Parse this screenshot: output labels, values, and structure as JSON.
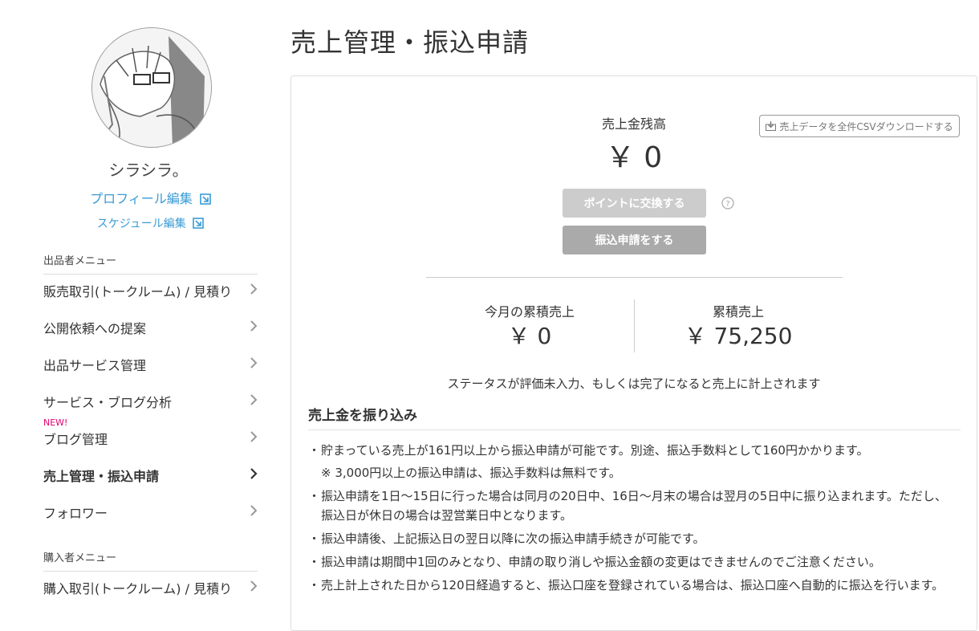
{
  "sidebar": {
    "username": "シラシラ。",
    "profile_edit": "プロフィール編集",
    "schedule_edit": "スケジュール編集",
    "seller_menu_heading": "出品者メニュー",
    "seller_items": [
      {
        "label": "販売取引(トークルーム) / 見積り"
      },
      {
        "label": "公開依頼への提案"
      },
      {
        "label": "出品サービス管理"
      },
      {
        "label": "サービス・ブログ分析"
      },
      {
        "label": "ブログ管理",
        "badge": "NEW!"
      },
      {
        "label": "売上管理・振込申請",
        "active": true
      },
      {
        "label": "フォロワー"
      }
    ],
    "buyer_menu_heading": "購入者メニュー",
    "buyer_items": [
      {
        "label": "購入取引(トークルーム) / 見積り"
      }
    ]
  },
  "main": {
    "title": "売上管理・振込申請",
    "balance_label": "売上金残高",
    "balance_value": "￥ 0",
    "csv_button": "売上データを全件CSVダウンロードする",
    "exchange_points_button": "ポイントに交換する",
    "transfer_request_button": "振込申請をする",
    "monthly_label": "今月の累積売上",
    "monthly_value": "￥ 0",
    "total_label": "累積売上",
    "total_value": "￥ 75,250",
    "status_note": "ステータスが評価未入力、もしくは完了になると売上に計上されます",
    "section_title": "売上金を振り込み",
    "notes": [
      "貯まっている売上が161円以上から振込申請が可能です。別途、振込手数料として160円かかります。",
      "振込申請を1日〜15日に行った場合は同月の20日中、16日〜月末の場合は翌月の5日中に振り込まれます。ただし、振込日が休日の場合は翌営業日中となります。",
      "振込申請後、上記振込日の翌日以降に次の振込申請手続きが可能です。",
      "振込申請は期間中1回のみとなり、申請の取り消しや振込金額の変更はできませんのでご注意ください。",
      "売上計上された日から120日経過すると、振込口座を登録されている場合は、振込口座へ自動的に振込を行います。"
    ],
    "subnote": "※ 3,000円以上の振込申請は、振込手数料は無料です。",
    "bullet": "・"
  },
  "colors": {
    "link": "#3a9bd5",
    "new_badge": "#e4006f",
    "button_disabled": "#cccccc",
    "button_primary": "#aaaaaa"
  },
  "icons": [
    "external-link-icon",
    "chevron-right-icon",
    "download-icon",
    "question-circle-icon"
  ]
}
